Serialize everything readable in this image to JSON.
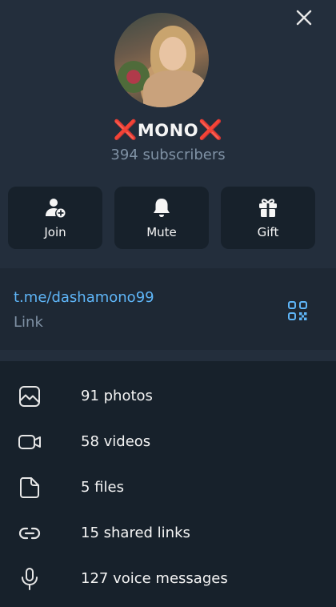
{
  "channel": {
    "name": "MONO",
    "decoration": "❌",
    "subscribers": "394 subscribers"
  },
  "actions": [
    {
      "label": "Join",
      "icon": "add-user-icon"
    },
    {
      "label": "Mute",
      "icon": "bell-icon"
    },
    {
      "label": "Gift",
      "icon": "gift-icon"
    }
  ],
  "link": {
    "url": "t.me/dashamono99",
    "caption": "Link"
  },
  "media": [
    {
      "label": "91 photos",
      "icon": "photo-icon"
    },
    {
      "label": "58 videos",
      "icon": "video-icon"
    },
    {
      "label": "5 files",
      "icon": "file-icon"
    },
    {
      "label": "15 shared links",
      "icon": "link-icon"
    },
    {
      "label": "127 voice messages",
      "icon": "microphone-icon"
    }
  ],
  "colors": {
    "background": "#17212b",
    "header": "#232e3c",
    "accent": "#5eb5f7",
    "muted": "#7f91a4",
    "decoration": "#e0242b"
  }
}
